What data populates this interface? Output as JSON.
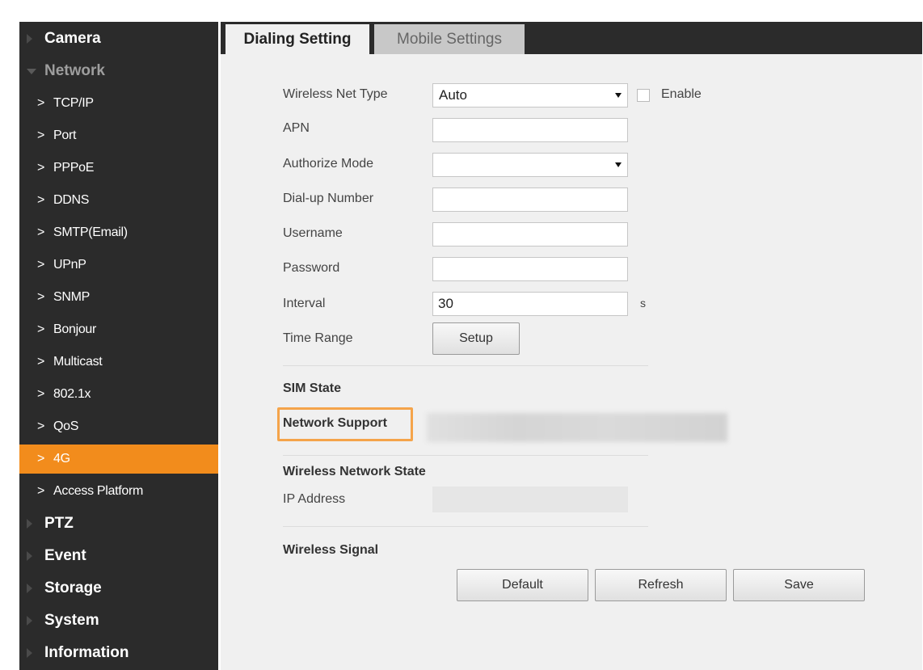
{
  "sidebar": {
    "items": [
      {
        "label": "Camera",
        "kind": "top",
        "state": "collapsed"
      },
      {
        "label": "Network",
        "kind": "top",
        "state": "expanded"
      },
      {
        "label": "TCP/IP",
        "kind": "sub"
      },
      {
        "label": "Port",
        "kind": "sub"
      },
      {
        "label": "PPPoE",
        "kind": "sub"
      },
      {
        "label": "DDNS",
        "kind": "sub"
      },
      {
        "label": "SMTP(Email)",
        "kind": "sub"
      },
      {
        "label": "UPnP",
        "kind": "sub"
      },
      {
        "label": "SNMP",
        "kind": "sub"
      },
      {
        "label": "Bonjour",
        "kind": "sub"
      },
      {
        "label": "Multicast",
        "kind": "sub"
      },
      {
        "label": "802.1x",
        "kind": "sub"
      },
      {
        "label": "QoS",
        "kind": "sub"
      },
      {
        "label": "4G",
        "kind": "sub",
        "active": true
      },
      {
        "label": "Access Platform",
        "kind": "sub"
      },
      {
        "label": "PTZ",
        "kind": "top",
        "state": "collapsed"
      },
      {
        "label": "Event",
        "kind": "top",
        "state": "collapsed"
      },
      {
        "label": "Storage",
        "kind": "top",
        "state": "collapsed"
      },
      {
        "label": "System",
        "kind": "top",
        "state": "collapsed"
      },
      {
        "label": "Information",
        "kind": "top",
        "state": "collapsed"
      }
    ]
  },
  "tabs": [
    {
      "label": "Dialing Setting",
      "active": true
    },
    {
      "label": "Mobile Settings",
      "active": false
    }
  ],
  "form": {
    "wireless_net_type": {
      "label": "Wireless Net Type",
      "value": "Auto"
    },
    "enable_label": "Enable",
    "apn": {
      "label": "APN",
      "value": ""
    },
    "authorize_mode": {
      "label": "Authorize Mode",
      "value": ""
    },
    "dialup_number": {
      "label": "Dial-up Number",
      "value": ""
    },
    "username": {
      "label": "Username",
      "value": ""
    },
    "password": {
      "label": "Password",
      "value": ""
    },
    "interval": {
      "label": "Interval",
      "value": "30",
      "unit": "s"
    },
    "time_range": {
      "label": "Time Range",
      "button": "Setup"
    }
  },
  "status": {
    "sim_state": "SIM State",
    "network_support": "Network Support",
    "wireless_network_state": "Wireless Network State",
    "ip_address_label": "IP Address",
    "wireless_signal": "Wireless Signal"
  },
  "buttons": {
    "default": "Default",
    "refresh": "Refresh",
    "save": "Save"
  },
  "colors": {
    "sidebar_bg": "#2b2b2b",
    "active_accent": "#f28c1c",
    "highlight_border": "#f5a44a",
    "panel_bg": "#f0f0f0"
  }
}
